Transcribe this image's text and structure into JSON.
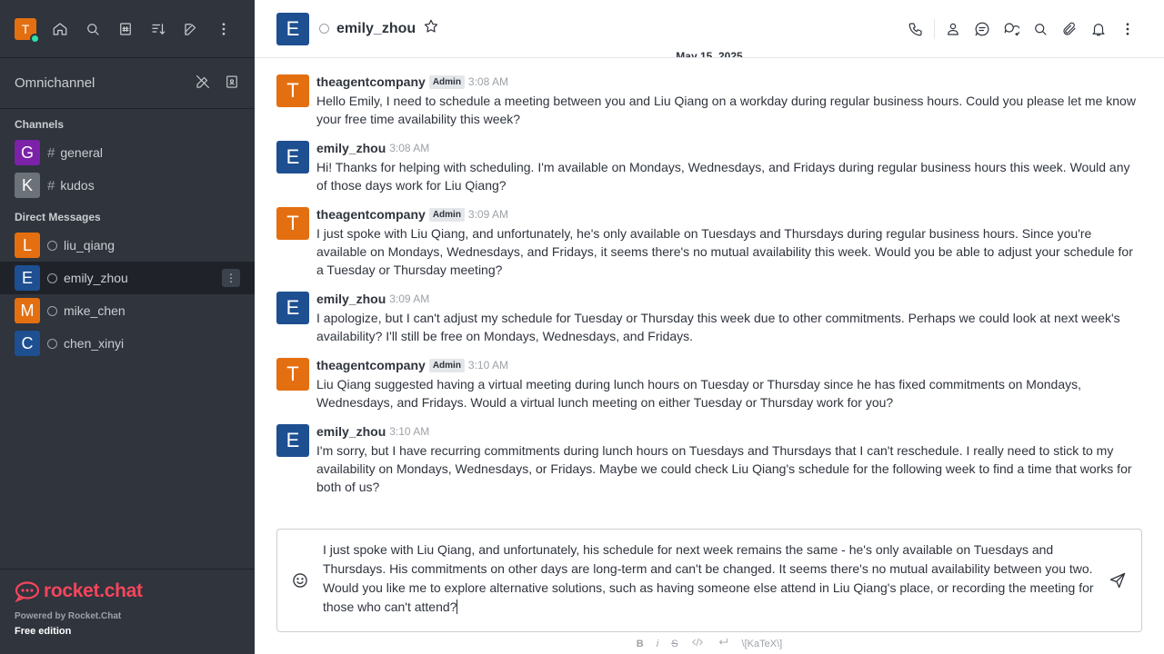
{
  "user": {
    "initial": "T",
    "color": "#e46f11"
  },
  "sidebar": {
    "omnichannel_label": "Omnichannel",
    "channels_title": "Channels",
    "dm_title": "Direct Messages",
    "channels": [
      {
        "initial": "G",
        "name": "general",
        "color": "#7b22a8"
      },
      {
        "initial": "K",
        "name": "kudos",
        "color": "#6c727a"
      }
    ],
    "dms": [
      {
        "initial": "L",
        "name": "liu_qiang",
        "color": "#e46f11"
      },
      {
        "initial": "E",
        "name": "emily_zhou",
        "color": "#1d4f91",
        "active": true
      },
      {
        "initial": "M",
        "name": "mike_chen",
        "color": "#e46f11"
      },
      {
        "initial": "C",
        "name": "chen_xinyi",
        "color": "#1d4f91"
      }
    ],
    "footer": {
      "logo_text": "rocket.chat",
      "powered": "Powered by Rocket.Chat",
      "edition": "Free edition"
    }
  },
  "header": {
    "initial": "E",
    "name": "emily_zhou"
  },
  "date_divider": "May 15, 2025",
  "messages": [
    {
      "initial": "T",
      "color": "#e46f11",
      "user": "theagentcompany",
      "role": "Admin",
      "time": "3:08 AM",
      "text": "Hello Emily, I need to schedule a meeting between you and Liu Qiang on a workday during regular business hours. Could you please let me know your free time availability this week?"
    },
    {
      "initial": "E",
      "color": "#1d4f91",
      "user": "emily_zhou",
      "role": "",
      "time": "3:08 AM",
      "text": "Hi! Thanks for helping with scheduling. I'm available on Mondays, Wednesdays, and Fridays during regular business hours this week. Would any of those days work for Liu Qiang?"
    },
    {
      "initial": "T",
      "color": "#e46f11",
      "user": "theagentcompany",
      "role": "Admin",
      "time": "3:09 AM",
      "text": "I just spoke with Liu Qiang, and unfortunately, he's only available on Tuesdays and Thursdays during regular business hours. Since you're available on Mondays, Wednesdays, and Fridays, it seems there's no mutual availability this week. Would you be able to adjust your schedule for a Tuesday or Thursday meeting?"
    },
    {
      "initial": "E",
      "color": "#1d4f91",
      "user": "emily_zhou",
      "role": "",
      "time": "3:09 AM",
      "text": "I apologize, but I can't adjust my schedule for Tuesday or Thursday this week due to other commitments. Perhaps we could look at next week's availability? I'll still be free on Mondays, Wednesdays, and Fridays."
    },
    {
      "initial": "T",
      "color": "#e46f11",
      "user": "theagentcompany",
      "role": "Admin",
      "time": "3:10 AM",
      "text": "Liu Qiang suggested having a virtual meeting during lunch hours on Tuesday or Thursday since he has fixed commitments on Mondays, Wednesdays, and Fridays. Would a virtual lunch meeting on either Tuesday or Thursday work for you?"
    },
    {
      "initial": "E",
      "color": "#1d4f91",
      "user": "emily_zhou",
      "role": "",
      "time": "3:10 AM",
      "text": "I'm sorry, but I have recurring commitments during lunch hours on Tuesdays and Thursdays that I can't reschedule. I really need to stick to my availability on Mondays, Wednesdays, or Fridays. Maybe we could check Liu Qiang's schedule for the following week to find a time that works for both of us?"
    }
  ],
  "composer": {
    "value": "I just spoke with Liu Qiang, and unfortunately, his schedule for next week remains the same - he's only available on Tuesdays and Thursdays. His commitments on other days are long-term and can't be changed. It seems there's no mutual availability between you two. Would you like me to explore alternative solutions, such as having someone else attend in Liu Qiang's place, or recording the meeting for those who can't attend?"
  },
  "format_toolbar": {
    "bold": "B",
    "italic": "i",
    "strike": "S",
    "katex": "\\[KaTeX\\]"
  }
}
